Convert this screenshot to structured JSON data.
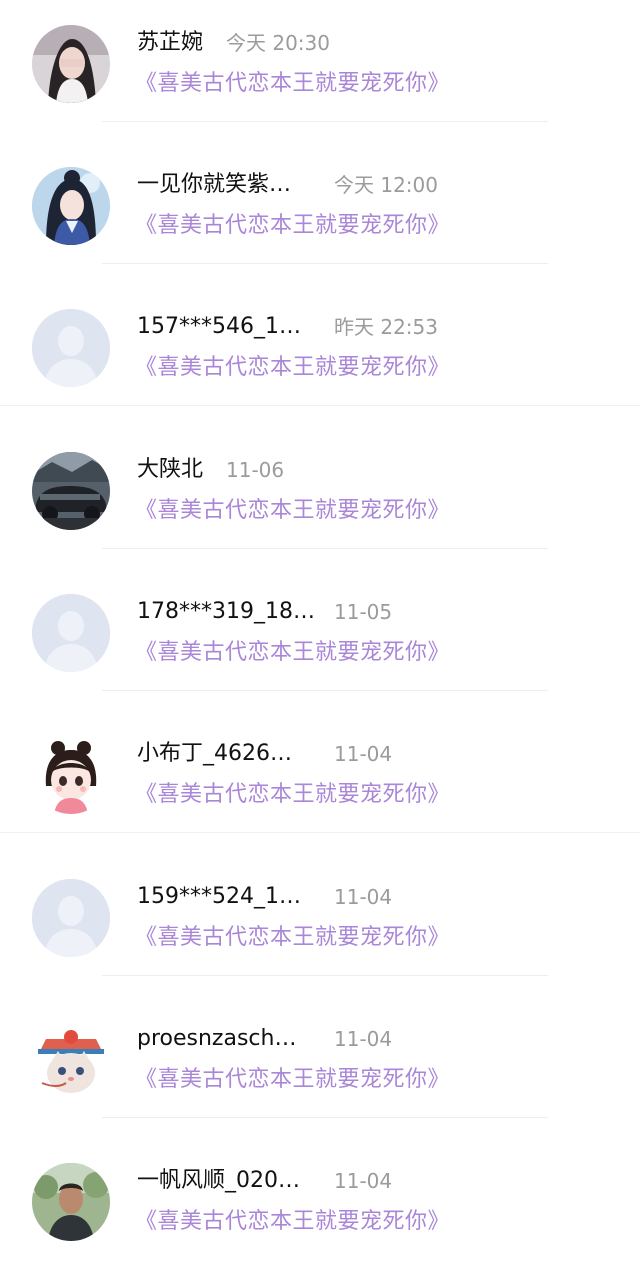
{
  "messages": [
    {
      "name": "苏芷婉",
      "time": "今天 20:30",
      "book": "《喜美古代恋本王就要宠死你》",
      "avatar": "photo-avatar"
    },
    {
      "name": "一见你就笑紫…",
      "time": "今天 12:00",
      "book": "《喜美古代恋本王就要宠死你》",
      "avatar": "anime-girl-avatar"
    },
    {
      "name": "157***546_1…",
      "time": "昨天 22:53",
      "book": "《喜美古代恋本王就要宠死你》",
      "avatar": "default-user-icon"
    },
    {
      "name": "大陕北",
      "time": "11-06",
      "book": "《喜美古代恋本王就要宠死你》",
      "avatar": "car-photo-avatar"
    },
    {
      "name": "178***319_18…",
      "time": "11-05",
      "book": "《喜美古代恋本王就要宠死你》",
      "avatar": "default-user-icon"
    },
    {
      "name": "小布丁_4626…",
      "time": "11-04",
      "book": "《喜美古代恋本王就要宠死你》",
      "avatar": "cartoon-girl-avatar"
    },
    {
      "name": "159***524_1…",
      "time": "11-04",
      "book": "《喜美古代恋本王就要宠死你》",
      "avatar": "default-user-icon"
    },
    {
      "name": "proesnzasch…",
      "time": "11-04",
      "book": "《喜美古代恋本王就要宠死你》",
      "avatar": "cat-cartoon-avatar"
    },
    {
      "name": "一帆风顺_020…",
      "time": "11-04",
      "book": "《喜美古代恋本王就要宠死你》",
      "avatar": "man-photo-avatar"
    }
  ],
  "colors": {
    "book_link": "#a986d8",
    "name_text": "#111111",
    "time_text": "#9b9b9b",
    "default_avatar_bg": "#dfe4f1"
  }
}
